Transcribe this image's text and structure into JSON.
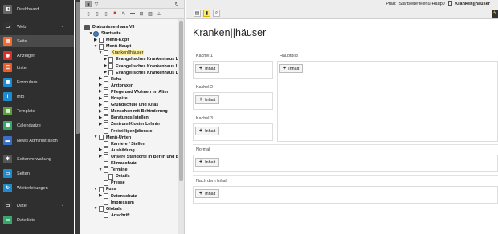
{
  "module_menu": [
    {
      "label": "Dashboard",
      "icon": "dashboard-icon",
      "color": "#666666",
      "glyph": "◧"
    },
    {
      "label": "Web",
      "icon": "web-icon",
      "color": "#333333",
      "glyph": "▭",
      "caret": "⌄"
    },
    {
      "label": "Seite",
      "icon": "page-module-icon",
      "color": "#f26a2d",
      "glyph": "▤"
    },
    {
      "label": "Anzeigen",
      "icon": "view-icon",
      "color": "#d6302b",
      "glyph": "◉"
    },
    {
      "label": "Liste",
      "icon": "list-icon",
      "color": "#e95d2b",
      "glyph": "☰"
    },
    {
      "label": "Formulare",
      "icon": "forms-icon",
      "color": "#1d8bd2",
      "glyph": "▦"
    },
    {
      "label": "Info",
      "icon": "info-icon",
      "color": "#1d8bd2",
      "glyph": "i"
    },
    {
      "label": "Template",
      "icon": "template-icon",
      "color": "#5c9f3c",
      "glyph": "▤"
    },
    {
      "label": "Calendarize",
      "icon": "calendar-icon",
      "color": "#37a86b",
      "glyph": "▦"
    },
    {
      "label": "News Administration",
      "icon": "news-icon",
      "color": "#3a6fc5",
      "glyph": "▬"
    },
    {
      "label": "Seitenverwaltung",
      "icon": "site-management-icon",
      "color": "#555555",
      "glyph": "✱",
      "caret": "⌄"
    },
    {
      "label": "Seiten",
      "icon": "sites-icon",
      "color": "#1d8bd2",
      "glyph": "▭"
    },
    {
      "label": "Weiterleitungen",
      "icon": "redirects-icon",
      "color": "#1d8bd2",
      "glyph": "↻"
    },
    {
      "label": "Datei",
      "icon": "file-icon",
      "color": "#333333",
      "glyph": "▭",
      "caret": "⌄"
    },
    {
      "label": "Dateiliste",
      "icon": "filelist-icon",
      "color": "#37a86b",
      "glyph": "▭"
    }
  ],
  "tree": {
    "root": "Diakonissenhaus V3",
    "nodes": [
      {
        "label": "Startseite",
        "level": 1,
        "exp": "▼",
        "icon": "globe",
        "bold": true
      },
      {
        "label": "Menü-Kopf",
        "level": 2,
        "exp": "▶",
        "icon": "page",
        "bold": true
      },
      {
        "label": "Menü-Haupt",
        "level": 2,
        "exp": "▼",
        "icon": "page",
        "bold": true
      },
      {
        "label": "Kranken||häuser",
        "level": 3,
        "exp": "▼",
        "icon": "page",
        "highlight": true
      },
      {
        "label": "Evangelisches Krankenhaus Lu",
        "level": 4,
        "exp": "▶",
        "icon": "page",
        "bold": true
      },
      {
        "label": "Evangelisches Krankenhaus Lu",
        "level": 4,
        "exp": "▶",
        "icon": "page",
        "bold": true
      },
      {
        "label": "Evangelisches Krankenhaus Lu",
        "level": 4,
        "exp": "▶",
        "icon": "page",
        "bold": true
      },
      {
        "label": "Reha",
        "level": 3,
        "exp": "▶",
        "icon": "page",
        "bold": true
      },
      {
        "label": "Arztpraxen",
        "level": 3,
        "exp": "▶",
        "icon": "page",
        "bold": true
      },
      {
        "label": "Pflege und Wohnen im Alter",
        "level": 3,
        "exp": "▶",
        "icon": "page",
        "bold": true
      },
      {
        "label": "Hospize",
        "level": 3,
        "exp": "▶",
        "icon": "page",
        "bold": true
      },
      {
        "label": "Grundschule und Kitas",
        "level": 3,
        "exp": "▶",
        "icon": "page",
        "bold": true
      },
      {
        "label": "Menschen mit Behinderung",
        "level": 3,
        "exp": "▶",
        "icon": "page",
        "bold": true
      },
      {
        "label": "Beratungs||stellen",
        "level": 3,
        "exp": "▶",
        "icon": "page",
        "bold": true
      },
      {
        "label": "Zentrum Kloster Lehnin",
        "level": 3,
        "exp": "▶",
        "icon": "page",
        "bold": true
      },
      {
        "label": "Freiwilligen||dienste",
        "level": 3,
        "exp": "",
        "icon": "page",
        "bold": true
      },
      {
        "label": "Menü-Unten",
        "level": 2,
        "exp": "▼",
        "icon": "page",
        "bold": true
      },
      {
        "label": "Karriere / Stellen",
        "level": 3,
        "exp": "",
        "icon": "page",
        "bold": true
      },
      {
        "label": "Ausbildung",
        "level": 3,
        "exp": "▶",
        "icon": "page",
        "bold": true
      },
      {
        "label": "Unsere Standorte in Berlin und B",
        "level": 3,
        "exp": "▶",
        "icon": "page",
        "bold": true
      },
      {
        "label": "Klimaschutz",
        "level": 3,
        "exp": "",
        "icon": "page",
        "bold": true
      },
      {
        "label": "Termine",
        "level": 3,
        "exp": "▼",
        "icon": "page",
        "bold": true
      },
      {
        "label": "Details",
        "level": 4,
        "exp": "",
        "icon": "page",
        "bold": true
      },
      {
        "label": "Presse",
        "level": 3,
        "exp": "",
        "icon": "page",
        "bold": true
      },
      {
        "label": "Fuss",
        "level": 2,
        "exp": "▼",
        "icon": "page",
        "bold": true
      },
      {
        "label": "Datenschutz",
        "level": 3,
        "exp": "▶",
        "icon": "page",
        "bold": true
      },
      {
        "label": "Impressum",
        "level": 3,
        "exp": "",
        "icon": "page",
        "bold": true
      },
      {
        "label": "Globals",
        "level": 2,
        "exp": "▼",
        "icon": "page",
        "bold": true
      },
      {
        "label": "Anschrift",
        "level": 3,
        "exp": "",
        "icon": "page",
        "bold": true
      }
    ]
  },
  "tree_toolbar": {
    "top_icons": [
      "tree-view-icon",
      "filter-icon",
      "refresh-icon"
    ],
    "actions": [
      "new-page-icon",
      "new-page-2-icon",
      "new-page-3-icon",
      "delete-icon",
      "edit-icon",
      "folder-icon",
      "move-icon",
      "trash-icon",
      "separator-icon"
    ]
  },
  "content": {
    "path_label": "Pfad: /Startseite/Menü-Haupt/",
    "path_current": "Kranken||häuser",
    "title": "Kranken||häuser",
    "columns": {
      "left": [
        {
          "label": "Kachel 1",
          "button": "Inhalt"
        },
        {
          "label": "Kachel 2",
          "button": "Inhalt"
        },
        {
          "label": "Kachel 3",
          "button": "Inhalt"
        },
        {
          "label": "Normal",
          "button": "Inhalt"
        },
        {
          "label": "Nach dem Inhalt",
          "button": "Inhalt"
        }
      ],
      "right": {
        "label": "Hauptbild",
        "button": "Inhalt"
      }
    }
  }
}
